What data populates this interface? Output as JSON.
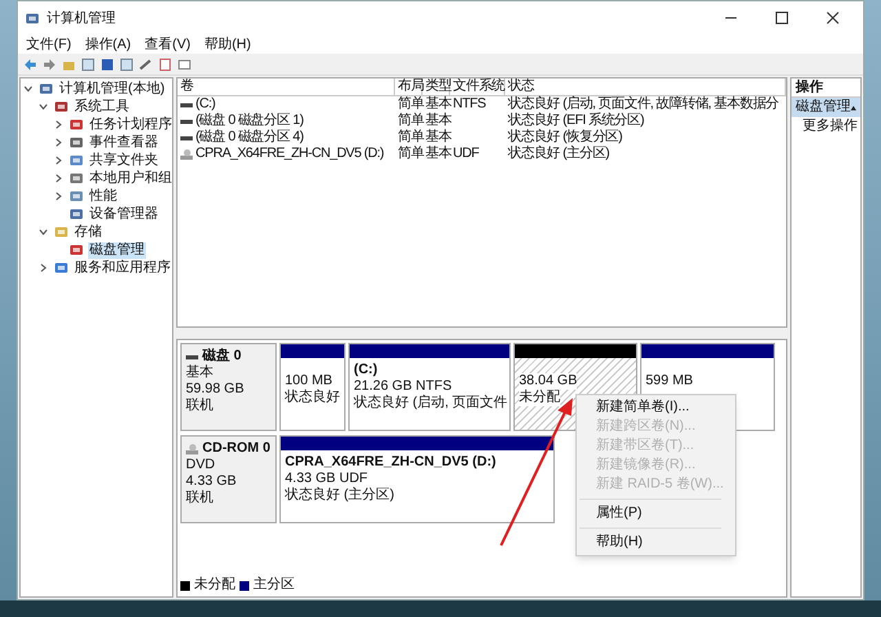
{
  "window": {
    "title": "计算机管理"
  },
  "menu": [
    "文件(F)",
    "操作(A)",
    "查看(V)",
    "帮助(H)"
  ],
  "tree": [
    {
      "label": "计算机管理(本地)",
      "expanded": true,
      "selected": false,
      "children": [
        {
          "label": "系统工具",
          "expanded": true,
          "selected": false,
          "children": [
            {
              "label": "任务计划程序",
              "expanded": false,
              "selected": false
            },
            {
              "label": "事件查看器",
              "expanded": false,
              "selected": false
            },
            {
              "label": "共享文件夹",
              "expanded": false,
              "selected": false
            },
            {
              "label": "本地用户和组",
              "expanded": false,
              "selected": false
            },
            {
              "label": "性能",
              "expanded": false,
              "selected": false
            },
            {
              "label": "设备管理器",
              "selected": false
            }
          ]
        },
        {
          "label": "存储",
          "expanded": true,
          "selected": false,
          "children": [
            {
              "label": "磁盘管理",
              "selected": true
            }
          ]
        },
        {
          "label": "服务和应用程序",
          "expanded": false,
          "selected": false
        }
      ]
    }
  ],
  "table": {
    "columns": [
      "卷",
      "布局",
      "类型",
      "文件系统",
      "状态"
    ],
    "rows": [
      {
        "kind": "disk",
        "cells": [
          "(C:)",
          "简单",
          "基本",
          "NTFS",
          "状态良好 (启动, 页面文件, 故障转储, 基本数据分"
        ]
      },
      {
        "kind": "disk",
        "cells": [
          "(磁盘 0 磁盘分区 1)",
          "简单",
          "基本",
          "",
          "状态良好 (EFI 系统分区)"
        ]
      },
      {
        "kind": "disk",
        "cells": [
          "(磁盘 0 磁盘分区 4)",
          "简单",
          "基本",
          "",
          "状态良好 (恢复分区)"
        ]
      },
      {
        "kind": "cd",
        "cells": [
          "CPRA_X64FRE_ZH-CN_DV5 (D:)",
          "简单",
          "基本",
          "UDF",
          "状态良好 (主分区)"
        ]
      }
    ]
  },
  "disks": [
    {
      "kind": "disk",
      "name": "磁盘 0",
      "lines": [
        "基本",
        "59.98 GB",
        "联机"
      ],
      "partitions": [
        {
          "color": "#000080",
          "hatched": false,
          "lines": [
            "100 MB",
            "状态良好"
          ]
        },
        {
          "color": "#000080",
          "hatched": false,
          "title": "(C:)",
          "lines": [
            "21.26 GB NTFS",
            "状态良好 (启动, 页面文件"
          ]
        },
        {
          "color": "#000000",
          "hatched": true,
          "lines": [
            "38.04 GB",
            "未分配"
          ]
        },
        {
          "color": "#000080",
          "hatched": false,
          "lines": [
            "599 MB"
          ]
        }
      ]
    },
    {
      "kind": "cd",
      "name": "CD-ROM 0",
      "lines": [
        "DVD",
        "4.33 GB",
        "联机"
      ],
      "partitions": [
        {
          "color": "#000080",
          "hatched": false,
          "title": "CPRA_X64FRE_ZH-CN_DV5  (D:)",
          "lines": [
            "4.33 GB UDF",
            "状态良好 (主分区)"
          ]
        }
      ]
    }
  ],
  "legend": [
    {
      "label": "未分配",
      "color": "#000000"
    },
    {
      "label": "主分区",
      "color": "#000080"
    }
  ],
  "actions": {
    "header": "操作",
    "section": "磁盘管理",
    "items": [
      "更多操作"
    ]
  },
  "context_menu": [
    {
      "kind": "item",
      "label": "新建简单卷(I)...",
      "disabled": false
    },
    {
      "kind": "item",
      "label": "新建跨区卷(N)...",
      "disabled": true
    },
    {
      "kind": "item",
      "label": "新建带区卷(T)...",
      "disabled": true
    },
    {
      "kind": "item",
      "label": "新建镜像卷(R)...",
      "disabled": true
    },
    {
      "kind": "item",
      "label": "新建 RAID-5 卷(W)...",
      "disabled": true
    },
    {
      "kind": "separator"
    },
    {
      "kind": "item",
      "label": "属性(P)",
      "disabled": false
    },
    {
      "kind": "separator"
    },
    {
      "kind": "item",
      "label": "帮助(H)",
      "disabled": false
    }
  ]
}
